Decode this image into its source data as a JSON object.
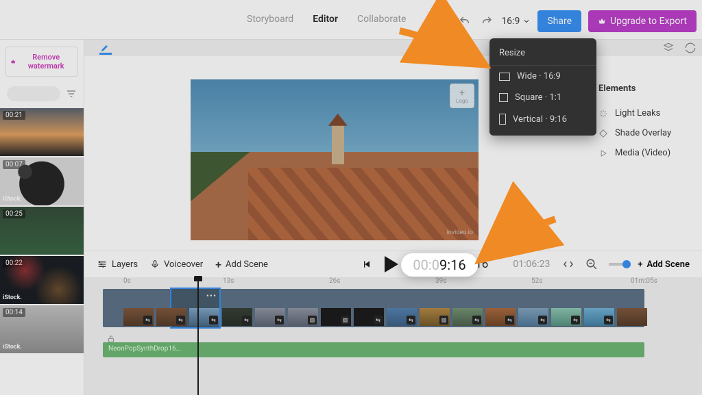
{
  "nav": {
    "storyboard": "Storyboard",
    "editor": "Editor",
    "collaborate": "Collaborate"
  },
  "top": {
    "aspect": "16:9",
    "share": "Share",
    "upgrade": "Upgrade to Export"
  },
  "watermark_btn": "Remove watermark",
  "thumbs": [
    {
      "time": "00:21",
      "stock": ""
    },
    {
      "time": "00:07",
      "stock": "iStock."
    },
    {
      "time": "00:25",
      "stock": ""
    },
    {
      "time": "00:22",
      "stock": "iStock."
    },
    {
      "time": "00:14",
      "stock": "iStock."
    }
  ],
  "preview": {
    "logo_label": "Logo",
    "watermark": "invideo.io"
  },
  "resize": {
    "header": "Resize",
    "options": [
      {
        "label": "Wide · 16:9"
      },
      {
        "label": "Square · 1:1"
      },
      {
        "label": "Vertical · 9:16"
      }
    ]
  },
  "right_panel": {
    "header": "Elements",
    "items": [
      {
        "label": "Light Leaks"
      },
      {
        "label": "Shade Overlay"
      },
      {
        "label": "Media (Video)"
      }
    ]
  },
  "tracks_head": {
    "layers": "Layers",
    "voiceover": "Voiceover",
    "add_scene": "Add Scene",
    "add_scene_right": "Add Scene",
    "current": "00:09:16",
    "duration": "01:06:23"
  },
  "bubble": {
    "pale": "00:0",
    "dark": "9:16"
  },
  "ruler": [
    "0s",
    "13s",
    "26s",
    "39s",
    "52s",
    "01m:05s"
  ],
  "audio": {
    "name": "NeonPopSynthDrop16…"
  }
}
